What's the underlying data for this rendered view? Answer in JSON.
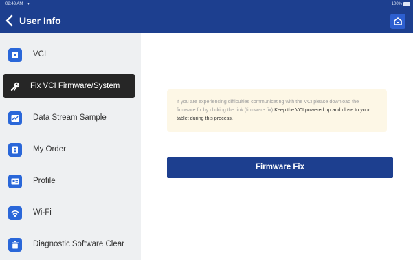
{
  "status_bar": {
    "time": "02:43 AM",
    "wifi_icon": "▾",
    "battery": "100%"
  },
  "header": {
    "title": "User Info",
    "back_icon": "chevron-left-icon",
    "home_icon": "home-icon"
  },
  "sidebar": {
    "items": [
      {
        "label": "VCI",
        "icon": "vci-icon",
        "active": false
      },
      {
        "label": "Fix VCI Firmware/System",
        "icon": "wrench-icon",
        "active": true
      },
      {
        "label": "Data Stream Sample",
        "icon": "chart-icon",
        "active": false
      },
      {
        "label": "My Order",
        "icon": "order-icon",
        "active": false
      },
      {
        "label": "Profile",
        "icon": "profile-icon",
        "active": false
      },
      {
        "label": "Wi-Fi",
        "icon": "wifi-icon",
        "active": false
      },
      {
        "label": "Diagnostic Software Clear",
        "icon": "trash-icon",
        "active": false
      }
    ]
  },
  "main": {
    "notice_text": "If you are experiencing difficulties communicating with the VCI please download the firmware fix by clicking the link (firmware fix).",
    "notice_emphasis": "Keep the VCI powered up and close to your tablet during this process.",
    "fix_button_label": "Firmware Fix"
  },
  "colors": {
    "header": "#1d3f8f",
    "accent": "#2a67d9",
    "sidebar_bg": "#eef0f2",
    "active_item": "#262626",
    "notice_bg": "#fdf7e6"
  }
}
